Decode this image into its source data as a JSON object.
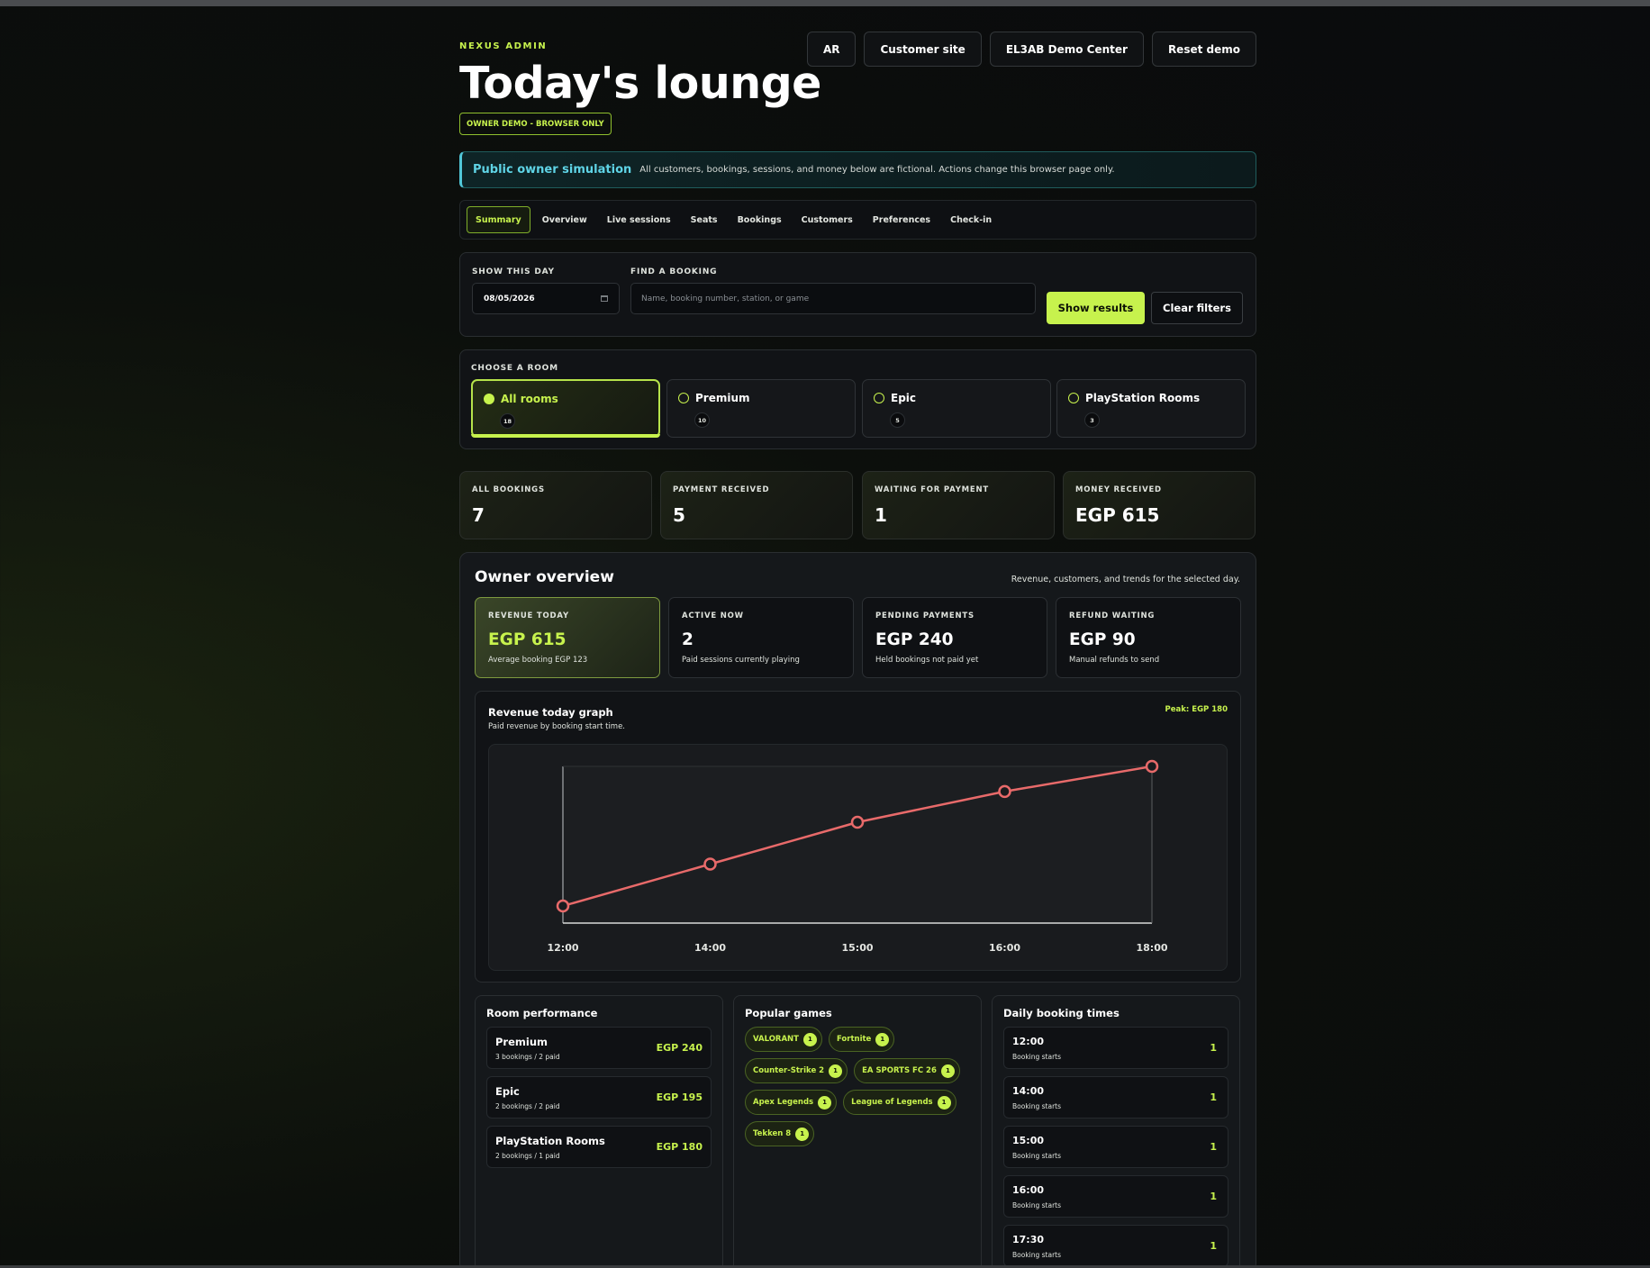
{
  "header": {
    "eyebrow": "NEXUS ADMIN",
    "title": "Today's lounge",
    "badge": "OWNER DEMO - BROWSER ONLY",
    "actions": [
      "AR",
      "Customer site",
      "EL3AB Demo Center",
      "Reset demo"
    ]
  },
  "notice": {
    "title": "Public owner simulation",
    "text": "All customers, bookings, sessions, and money below are fictional. Actions change this browser page only."
  },
  "tabs": [
    "Summary",
    "Overview",
    "Live sessions",
    "Seats",
    "Bookings",
    "Customers",
    "Preferences",
    "Check-in"
  ],
  "active_tab": "Summary",
  "filters": {
    "date_label": "SHOW THIS DAY",
    "date_value": "08/05/2026",
    "search_label": "FIND A BOOKING",
    "search_placeholder": "Name, booking number, station, or game",
    "show_button": "Show results",
    "clear_button": "Clear filters"
  },
  "rooms": {
    "label": "CHOOSE A ROOM",
    "items": [
      {
        "name": "All rooms",
        "count": "18",
        "selected": true
      },
      {
        "name": "Premium",
        "count": "10",
        "selected": false
      },
      {
        "name": "Epic",
        "count": "5",
        "selected": false
      },
      {
        "name": "PlayStation Rooms",
        "count": "3",
        "selected": false
      }
    ]
  },
  "stats": [
    {
      "label": "ALL BOOKINGS",
      "value": "7"
    },
    {
      "label": "PAYMENT RECEIVED",
      "value": "5"
    },
    {
      "label": "WAITING FOR PAYMENT",
      "value": "1"
    },
    {
      "label": "MONEY RECEIVED",
      "value": "EGP 615"
    }
  ],
  "overview": {
    "title": "Owner overview",
    "subtitle": "Revenue, customers, and trends for the selected day.",
    "kpis": [
      {
        "label": "REVENUE TODAY",
        "value": "EGP 615",
        "note": "Average booking EGP 123"
      },
      {
        "label": "ACTIVE NOW",
        "value": "2",
        "note": "Paid sessions currently playing"
      },
      {
        "label": "PENDING PAYMENTS",
        "value": "EGP 240",
        "note": "Held bookings not paid yet"
      },
      {
        "label": "REFUND WAITING",
        "value": "EGP 90",
        "note": "Manual refunds to send"
      }
    ],
    "graph": {
      "title": "Revenue today graph",
      "subtitle": "Paid revenue by booking start time.",
      "peak": "Peak: EGP 180"
    },
    "room_performance": {
      "title": "Room performance",
      "rows": [
        {
          "name": "Premium",
          "meta": "3 bookings / 2 paid",
          "amount": "EGP 240"
        },
        {
          "name": "Epic",
          "meta": "2 bookings / 2 paid",
          "amount": "EGP 195"
        },
        {
          "name": "PlayStation Rooms",
          "meta": "2 bookings / 1 paid",
          "amount": "EGP 180"
        }
      ]
    },
    "popular_games": {
      "title": "Popular games",
      "chips": [
        {
          "name": "VALORANT",
          "count": "1"
        },
        {
          "name": "Fortnite",
          "count": "1"
        },
        {
          "name": "Counter-Strike 2",
          "count": "1"
        },
        {
          "name": "EA SPORTS FC 26",
          "count": "1"
        },
        {
          "name": "Apex Legends",
          "count": "1"
        },
        {
          "name": "League of Legends",
          "count": "1"
        },
        {
          "name": "Tekken 8",
          "count": "1"
        }
      ]
    },
    "booking_times": {
      "title": "Daily booking times",
      "rows": [
        {
          "time": "12:00",
          "meta": "Booking starts",
          "count": "1"
        },
        {
          "time": "14:00",
          "meta": "Booking starts",
          "count": "1"
        },
        {
          "time": "15:00",
          "meta": "Booking starts",
          "count": "1"
        },
        {
          "time": "16:00",
          "meta": "Booking starts",
          "count": "1"
        },
        {
          "time": "17:30",
          "meta": "Booking starts",
          "count": "1"
        }
      ]
    }
  },
  "chart_data": {
    "type": "line",
    "title": "Revenue today graph",
    "subtitle": "Paid revenue by booking start time.",
    "categories": [
      "12:00",
      "14:00",
      "15:00",
      "16:00",
      "18:00"
    ],
    "values": [
      30,
      75,
      120,
      153,
      180
    ],
    "line_color": "#e86a6a",
    "grid": false
  },
  "colors": {
    "accent": "#c7f24d",
    "info": "#5fd4e6",
    "line": "#e86a6a"
  }
}
